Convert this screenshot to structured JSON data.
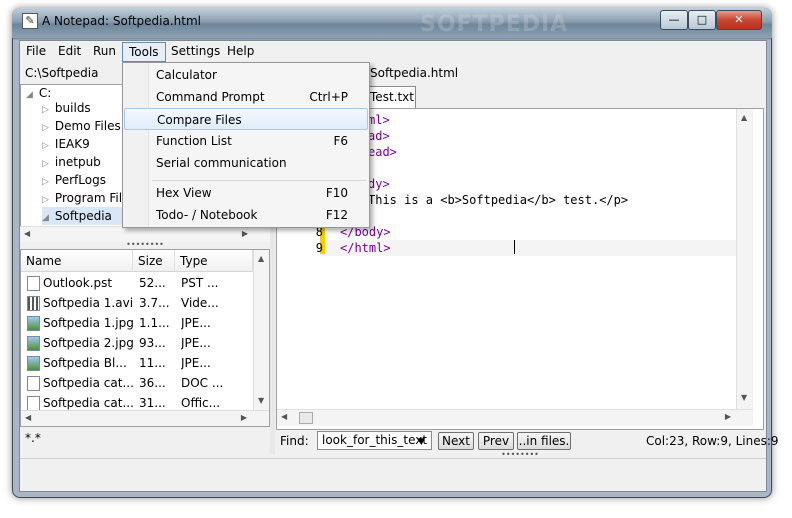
{
  "window": {
    "title": "A Notepad: Softpedia.html",
    "watermark": "SOFTPEDIA",
    "controls": {
      "minimize": "—",
      "maximize": "□",
      "close": "✕"
    }
  },
  "menubar": [
    "File",
    "Edit",
    "Run",
    "Tools",
    "Settings",
    "Help"
  ],
  "tools_menu": {
    "items": [
      {
        "label": "Calculator",
        "shortcut": ""
      },
      {
        "label": "Command Prompt",
        "shortcut": "Ctrl+P"
      },
      {
        "label": "Compare Files",
        "shortcut": ""
      },
      {
        "label": "Function List",
        "shortcut": "F6"
      },
      {
        "label": "Serial communication",
        "shortcut": ""
      },
      {
        "label": "Hex View",
        "shortcut": "F10"
      },
      {
        "label": "Todo- / Notebook",
        "shortcut": "F12"
      }
    ]
  },
  "left_panel": {
    "path": "C:\\Softpedia",
    "tree_root": "C:",
    "tree": [
      "builds",
      "Demo Files",
      "IEAK9",
      "inetpub",
      "PerfLogs",
      "Program Files",
      "Softpedia"
    ],
    "selected": "Softpedia",
    "columns": [
      "Name",
      "Size",
      "Type"
    ],
    "files": [
      {
        "name": "Outlook.pst",
        "size": "52...",
        "type": "PST ...",
        "icon": "file-icon"
      },
      {
        "name": "Softpedia 1.avi",
        "size": "3.7...",
        "type": "Vide...",
        "icon": "video-icon"
      },
      {
        "name": "Softpedia 1.jpg",
        "size": "1.1...",
        "type": "JPE...",
        "icon": "image-icon"
      },
      {
        "name": "Softpedia 2.jpg",
        "size": "93...",
        "type": "JPE...",
        "icon": "image-icon"
      },
      {
        "name": "Softpedia Bl...",
        "size": "11...",
        "type": "JPE...",
        "icon": "image-icon"
      },
      {
        "name": "Softpedia cat...",
        "size": "36...",
        "type": "DOC ...",
        "icon": "file-icon"
      },
      {
        "name": "Softpedia cat...",
        "size": "31...",
        "type": "Offic...",
        "icon": "file-icon"
      }
    ],
    "filter": "*.*"
  },
  "editor": {
    "file_title": "Softpedia.html",
    "active_tab": "Test.txt",
    "line_numbers": [
      "8",
      "9"
    ],
    "lines": [
      {
        "text": "ml>",
        "tag": true
      },
      {
        "text": "ad>",
        "tag": true
      },
      {
        "text": "ead>",
        "tag": true
      },
      {
        "text": "",
        "tag": false
      },
      {
        "text": "dy>",
        "tag": true
      },
      {
        "text": "This is a <b>Softpedia</b> test.</p>",
        "tag": false
      },
      {
        "text": "",
        "tag": false
      },
      {
        "text": "</body>",
        "tag": true
      },
      {
        "text": "</html>",
        "tag": true
      }
    ]
  },
  "findbar": {
    "label": "Find:",
    "value": "look_for_this_text",
    "next": "Next",
    "prev": "Prev",
    "in_files": "..in files.",
    "status": "Col:23, Row:9, Lines:9"
  }
}
